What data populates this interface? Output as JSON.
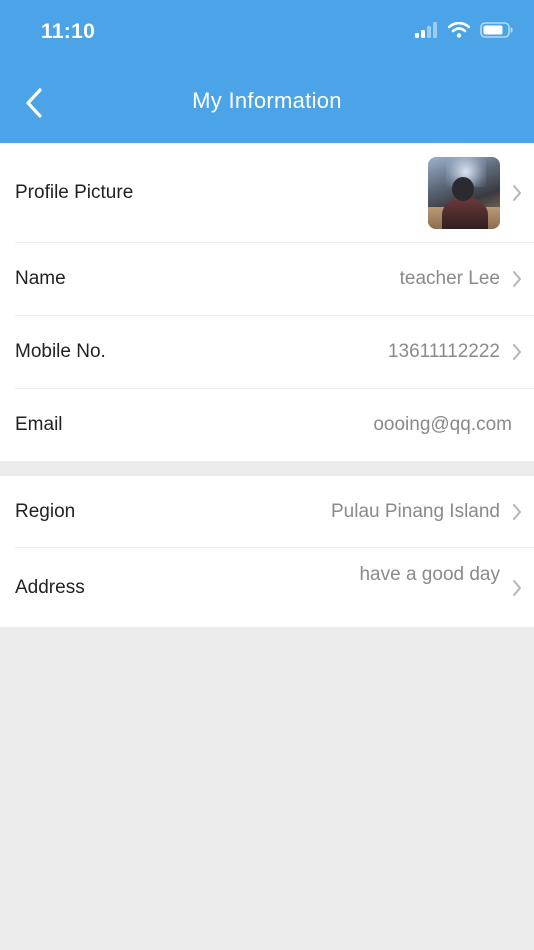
{
  "status_bar": {
    "time": "11:10",
    "icons": [
      "signal-icon",
      "wifi-icon",
      "battery-icon"
    ]
  },
  "nav": {
    "back_icon": "chevron-left-icon",
    "title": "My Information"
  },
  "colors": {
    "header": "#4ba3e8",
    "page_bg": "#ebebeb",
    "value_text": "#8a8a8a"
  },
  "profile": {
    "picture_label": "Profile Picture",
    "name_label": "Name",
    "name_value": "teacher Lee",
    "mobile_label": "Mobile No.",
    "mobile_value": "13611112222",
    "email_label": "Email",
    "email_value": "oooing@qq.com"
  },
  "location": {
    "region_label": "Region",
    "region_value": "Pulau Pinang Island",
    "address_label": "Address",
    "address_value": "have a good day"
  }
}
